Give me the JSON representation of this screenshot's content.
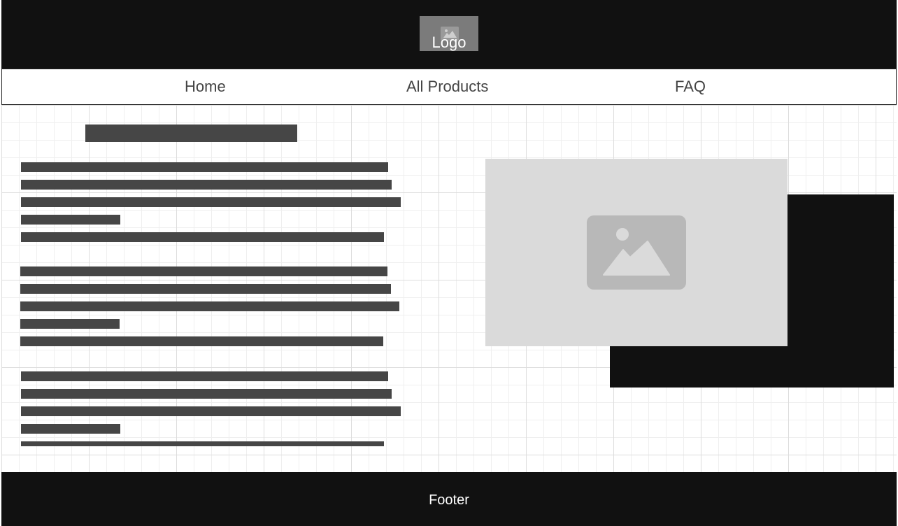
{
  "header": {
    "logo_label": "Logo",
    "logo_icon": "image-icon"
  },
  "nav": {
    "items": [
      {
        "label": "Home"
      },
      {
        "label": "All Products"
      },
      {
        "label": "FAQ"
      }
    ]
  },
  "main": {
    "image_icon": "image-icon"
  },
  "footer": {
    "label": "Footer"
  },
  "colors": {
    "header_bg": "#111111",
    "footer_bg": "#111111",
    "text_placeholder": "#464646",
    "image_placeholder": "#dadada",
    "logo_placeholder": "#7b7b7b"
  }
}
